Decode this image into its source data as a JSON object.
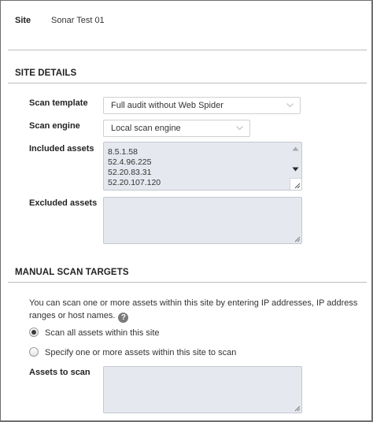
{
  "site": {
    "label": "Site",
    "name": "Sonar Test 01"
  },
  "site_details": {
    "heading": "SITE DETAILS",
    "scan_template": {
      "label": "Scan template",
      "value": "Full audit without Web Spider"
    },
    "scan_engine": {
      "label": "Scan engine",
      "value": "Local scan engine"
    },
    "included_assets": {
      "label": "Included assets",
      "items": [
        "8.5.1.58",
        "52.4.96.225",
        "52.20.83.31",
        "52.20.107.120"
      ]
    },
    "excluded_assets": {
      "label": "Excluded assets",
      "value": ""
    }
  },
  "manual_scan_targets": {
    "heading": "MANUAL SCAN TARGETS",
    "description": "You can scan one or more assets within this site by entering IP addresses, IP address ranges or host names.",
    "help_glyph": "?",
    "options": [
      {
        "label": "Scan all assets within this site",
        "selected": true
      },
      {
        "label": "Specify one or more assets within this site to scan",
        "selected": false
      }
    ],
    "assets_to_scan": {
      "label": "Assets to scan",
      "value": ""
    }
  }
}
